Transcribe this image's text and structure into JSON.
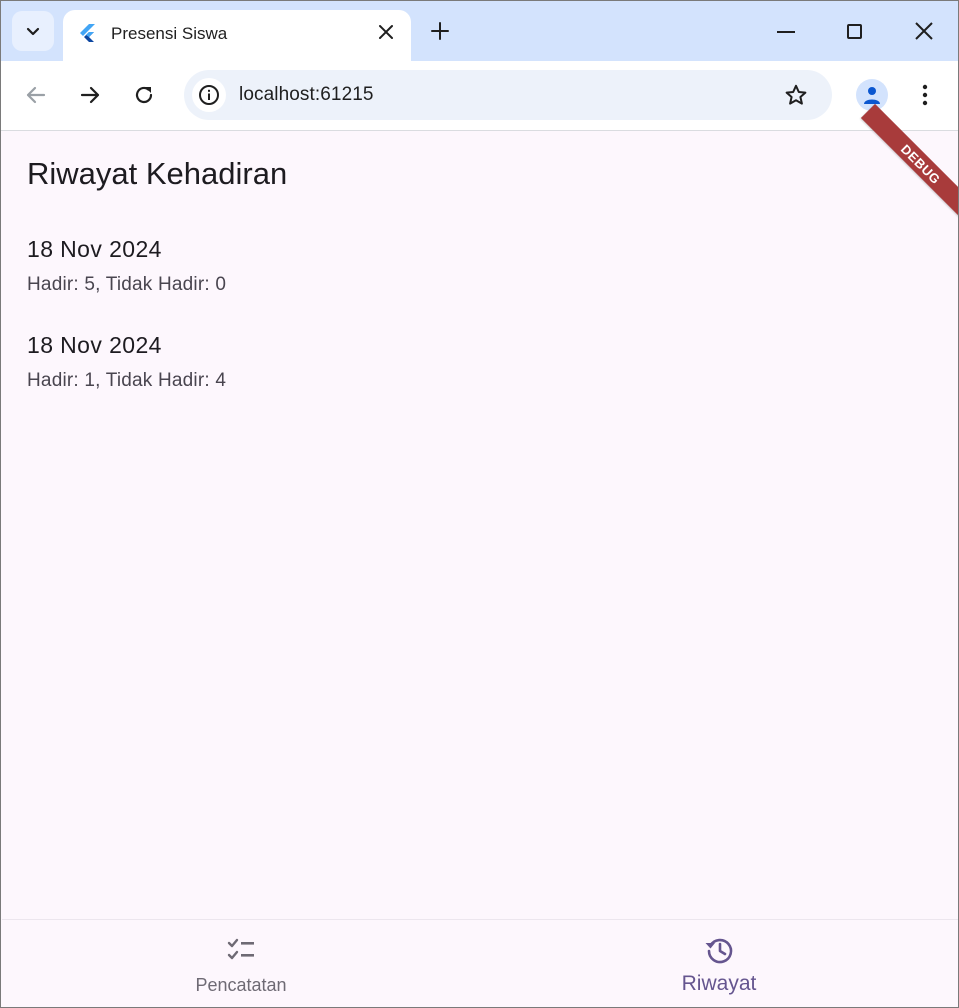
{
  "browser": {
    "tab_title": "Presensi Siswa",
    "url": "localhost:61215",
    "icons": {
      "tab_search": "chevron-down-icon",
      "favicon": "flutter-icon",
      "tab_close": "close-icon",
      "new_tab": "plus-icon",
      "back": "arrow-left-icon",
      "forward": "arrow-right-icon",
      "reload": "reload-icon",
      "site_info": "info-icon",
      "bookmark": "star-icon",
      "profile": "person-icon",
      "menu": "kebab-icon"
    }
  },
  "app": {
    "title": "Riwayat Kehadiran",
    "debug_banner": "DEBUG",
    "records": [
      {
        "date": "18 Nov 2024",
        "summary": "Hadir: 5, Tidak Hadir: 0"
      },
      {
        "date": "18 Nov 2024",
        "summary": "Hadir: 1, Tidak Hadir: 4"
      }
    ],
    "bottom_nav": [
      {
        "label": "Pencatatan",
        "icon": "checklist-icon",
        "active": false
      },
      {
        "label": "Riwayat",
        "icon": "history-icon",
        "active": true
      }
    ]
  },
  "colors": {
    "accent": "#65558f",
    "background": "#fdf7fd",
    "debug": "#a83b3b",
    "tabstrip": "#d3e3fd"
  }
}
